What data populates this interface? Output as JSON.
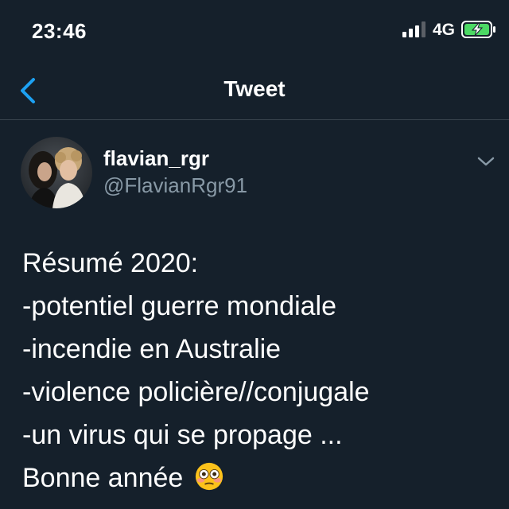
{
  "status_bar": {
    "time": "23:46",
    "network": "4G",
    "battery_color": "#4cd964",
    "signal_icon": "cellular-signal-icon",
    "battery_icon": "battery-charging-icon"
  },
  "nav": {
    "title": "Tweet",
    "back_icon": "chevron-left-icon",
    "accent_color": "#1da1f2"
  },
  "tweet": {
    "display_name": "flavian_rgr",
    "handle": "@FlavianRgr91",
    "more_icon": "chevron-down-icon",
    "lines": [
      "Résumé 2020:",
      "-potentiel guerre mondiale",
      "-incendie en Australie",
      "-violence policière//conjugale",
      "-un virus qui se propage ...",
      "Bonne année"
    ],
    "emoji": "flushed-face-emoji"
  },
  "colors": {
    "background": "#15202b",
    "secondary_text": "#8899a6",
    "divider": "#38444d"
  }
}
